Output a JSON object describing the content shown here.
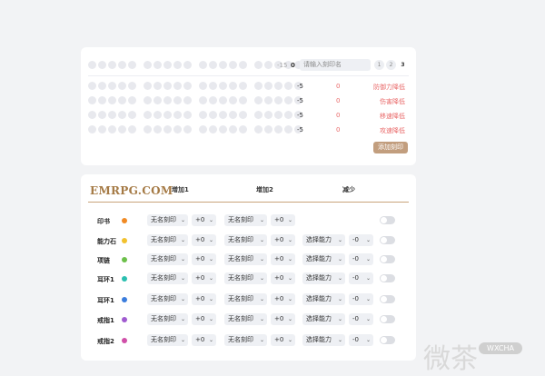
{
  "top_panel": {
    "count_value": "-15",
    "count_zero": "0",
    "search_placeholder": "请输入刻印名",
    "pages": [
      "1",
      "2",
      "3"
    ],
    "rows": [
      {
        "value": "-5",
        "zero": "0",
        "effect": "防御力降低"
      },
      {
        "value": "-5",
        "zero": "0",
        "effect": "伤害降低"
      },
      {
        "value": "-5",
        "zero": "0",
        "effect": "移速降低"
      },
      {
        "value": "-5",
        "zero": "0",
        "effect": "攻速降低"
      }
    ],
    "add_button": "添加刻印"
  },
  "bottom_panel": {
    "logo": "EMRPG.COM",
    "headers": {
      "add1": "增加1",
      "add2": "增加2",
      "reduce": "减少"
    },
    "slots": [
      {
        "label": "印书",
        "color": "#f08a24",
        "engrave1": "无名刻印",
        "val1": "+0",
        "engrave2": "无名刻印",
        "val2": "+0",
        "ability": "",
        "reduce": ""
      },
      {
        "label": "能力石",
        "color": "#f2c12e",
        "engrave1": "无名刻印",
        "val1": "+0",
        "engrave2": "无名刻印",
        "val2": "+0",
        "ability": "选择能力",
        "reduce": "-0"
      },
      {
        "label": "项链",
        "color": "#6cc04a",
        "engrave1": "无名刻印",
        "val1": "+0",
        "engrave2": "无名刻印",
        "val2": "+0",
        "ability": "选择能力",
        "reduce": "-0"
      },
      {
        "label": "耳环1",
        "color": "#2bbfb0",
        "engrave1": "无名刻印",
        "val1": "+0",
        "engrave2": "无名刻印",
        "val2": "+0",
        "ability": "选择能力",
        "reduce": "-0"
      },
      {
        "label": "耳环1",
        "color": "#3b7ddd",
        "engrave1": "无名刻印",
        "val1": "+0",
        "engrave2": "无名刻印",
        "val2": "+0",
        "ability": "选择能力",
        "reduce": "-0"
      },
      {
        "label": "戒指1",
        "color": "#a05bd0",
        "engrave1": "无名刻印",
        "val1": "+0",
        "engrave2": "无名刻印",
        "val2": "+0",
        "ability": "选择能力",
        "reduce": "-0"
      },
      {
        "label": "戒指2",
        "color": "#d04fa8",
        "engrave1": "无名刻印",
        "val1": "+0",
        "engrave2": "无名刻印",
        "val2": "+0",
        "ability": "选择能力",
        "reduce": "-0"
      }
    ]
  },
  "watermark": {
    "text": "微茶",
    "badge": "WXCHA"
  },
  "colors": {
    "accent": "#c29e7e",
    "effect_red": "#e96a6a",
    "logo_gold": "#a57a45"
  }
}
